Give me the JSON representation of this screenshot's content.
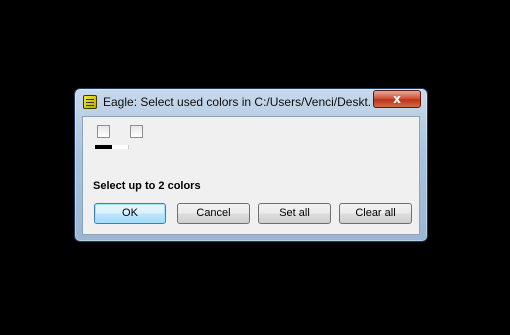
{
  "window": {
    "title": "Eagle: Select used colors in C:/Users/Venci/Deskt...",
    "close_label": "x"
  },
  "colors": [
    {
      "checked": false,
      "swatch_color": "#000000"
    },
    {
      "checked": false,
      "swatch_color": "#ffffff"
    }
  ],
  "status": {
    "text": "Select up to 2 colors"
  },
  "buttons": {
    "ok": "OK",
    "cancel": "Cancel",
    "set_all": "Set all",
    "clear_all": "Clear all"
  },
  "theme": {
    "desktop_background": "#000000",
    "dialog_body": "#f0f0f0",
    "titlebar": "#b4cbe4",
    "close_button": "#c9442a"
  }
}
